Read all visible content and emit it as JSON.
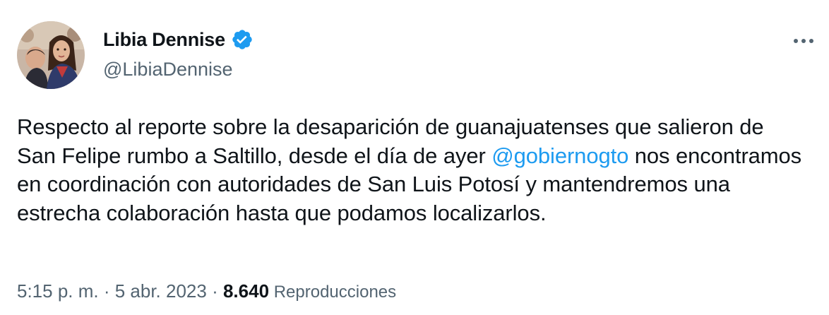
{
  "author": {
    "name": "Libia Dennise",
    "handle": "@LibiaDennise",
    "verified_color": "#1d9bf0"
  },
  "tweet": {
    "text_part1": "Respecto al reporte sobre la desaparición de guanajuatenses que salieron de San Felipe rumbo a Saltillo, desde el día de ayer ",
    "mention": "@gobiernogto",
    "text_part2": " nos encontramos en coordinación con autoridades de San Luis Potosí y mantendremos una estrecha colaboración hasta que podamos localizarlos."
  },
  "meta": {
    "time": "5:15 p. m.",
    "sep1": " · ",
    "date": "5 abr. 2023",
    "sep2": " · ",
    "views_count": "8.640",
    "views_label": " Reproducciones"
  },
  "icons": {
    "more": "more-horizontal-icon",
    "verified": "verified-badge-icon"
  },
  "colors": {
    "text": "#0f1419",
    "secondary": "#536471",
    "link": "#1d9bf0"
  }
}
